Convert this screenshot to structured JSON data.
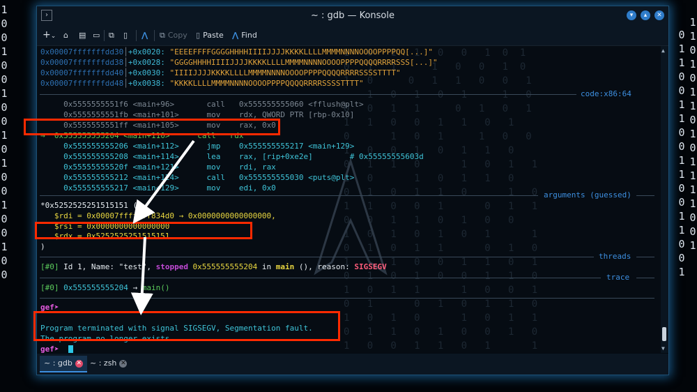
{
  "window": {
    "title": "~ : gdb — Konsole",
    "app_icon": "chevron-right-icon",
    "controls": [
      "minimize-icon",
      "maximize-icon",
      "close-icon"
    ]
  },
  "toolbar": {
    "new_tab_icon": "plus-icon",
    "items": [
      {
        "name": "copy-icon-button"
      },
      {
        "name": "print-icon"
      },
      {
        "name": "split-view-icon"
      },
      {
        "name": "clipboard-icon"
      },
      {
        "name": "find-icon"
      }
    ],
    "copy_label": "Copy",
    "paste_label": "Paste",
    "find_label": "Find"
  },
  "stack": [
    {
      "addr": "0x00007fffffffdd30",
      "off": "+0x0020:",
      "val": "\"EEEEFFFFGGGGHHHHIIIIJJJJKKKKLLLLMMMMNNNNOOOOPPPPQQ[...]\""
    },
    {
      "addr": "0x00007fffffffdd38",
      "off": "+0x0028:",
      "val": "\"GGGGHHHHIIIIJJJJKKKKLLLLMMMMNNNNOOOOPPPPQQQQRRRRSSS[...]\""
    },
    {
      "addr": "0x00007fffffffdd40",
      "off": "+0x0030:",
      "val": "\"IIIIJJJJKKKKLLLLMMMMNNNNOOOOPPPPQQQQRRRRSSSSTTTT\""
    },
    {
      "addr": "0x00007fffffffdd48",
      "off": "+0x0038:",
      "val": "\"KKKKLLLLMMMMNNNNOOOOPPPPQQQQRRRRSSSSTTTT\""
    }
  ],
  "sections": {
    "code": "code:x86:64",
    "arguments": "arguments (guessed)",
    "threads": "threads",
    "trace": "trace"
  },
  "code": [
    {
      "prefix": "  ",
      "addr": "0x5555555551f6",
      "sym": "<main+96>",
      "mn": "call",
      "op": "0x555555555060 <fflush@plt>",
      "current": false
    },
    {
      "prefix": "  ",
      "addr": "0x5555555551fb",
      "sym": "<main+101>",
      "mn": "mov",
      "op": "rdx, QWORD PTR [rbp-0x10]",
      "current": false
    },
    {
      "prefix": "  ",
      "addr": "0x5555555551ff",
      "sym": "<main+105>",
      "mn": "mov",
      "op": "rax, 0x0",
      "current": false
    },
    {
      "prefix": "→ ",
      "addr": "0x555555555204",
      "sym": "<main+110>",
      "mn": "call",
      "op": "rdx",
      "current": true
    },
    {
      "prefix": "  ",
      "addr": "0x555555555206",
      "sym": "<main+112>",
      "mn": "jmp",
      "op": "0x555555555217 <main+129>",
      "current": false
    },
    {
      "prefix": "  ",
      "addr": "0x555555555208",
      "sym": "<main+114>",
      "mn": "lea",
      "op": "rax, [rip+0xe2e]        # 0x55555555603d",
      "current": false
    },
    {
      "prefix": "  ",
      "addr": "0x55555555520f",
      "sym": "<main+121>",
      "mn": "mov",
      "op": "rdi, rax",
      "current": false
    },
    {
      "prefix": "  ",
      "addr": "0x555555555212",
      "sym": "<main+124>",
      "mn": "call",
      "op": "0x555555555030 <puts@plt>",
      "current": false
    },
    {
      "prefix": "  ",
      "addr": "0x555555555217",
      "sym": "<main+129>",
      "mn": "mov",
      "op": "edi, 0x0",
      "current": false
    }
  ],
  "arguments": {
    "head": "*0x5252525251515151 (",
    "rdi": "   $rdi = 0x00007fffffff834d0 → 0x0000000000000000,",
    "rsi": "   $rsi = 0x0000000000000000",
    "rdx": "   $rdx = 0x5252525251515151",
    "tail": ")"
  },
  "thread": {
    "id": "[#0]",
    "text1": " Id 1, Name: \"test\", ",
    "stopped": "stopped",
    "addr": " 0x555555555204",
    "in": " in ",
    "fn": "main",
    "text2": " (), reason: ",
    "reason": "SIGSEGV"
  },
  "trace": {
    "id": "[#0]",
    "addr": " 0x555555555204",
    "arrow": " → ",
    "fn": "main()"
  },
  "prompt": "gef➤",
  "messages": [
    "Program terminated with signal SIGSEGV, Segmentation fault.",
    "The program no longer exists."
  ],
  "tabs": [
    {
      "label": "~ : gdb",
      "active": true
    },
    {
      "label": "~ : zsh",
      "active": false
    }
  ],
  "background_digits": {
    "left": "1\n0\n0\n1\n0\n0\n1\n0\n0\n1\n0\n1\n0\n0\n1\n0\n0\n1\n0\n0",
    "right_a": "0\n1\n1\n0\n0\n1\n1\n0\n0\n1\n1\n0\n0\n1\n1\n0\n0\n1",
    "right_b": "1\n1\n0\n1\n0\n1\n1\n0\n1\n0\n1\n1\n1\n1\n0\n0\n1"
  },
  "colors": {
    "accent": "#3d8fe0",
    "annotation_red": "#ff2a00",
    "glow": "#2896e6"
  }
}
